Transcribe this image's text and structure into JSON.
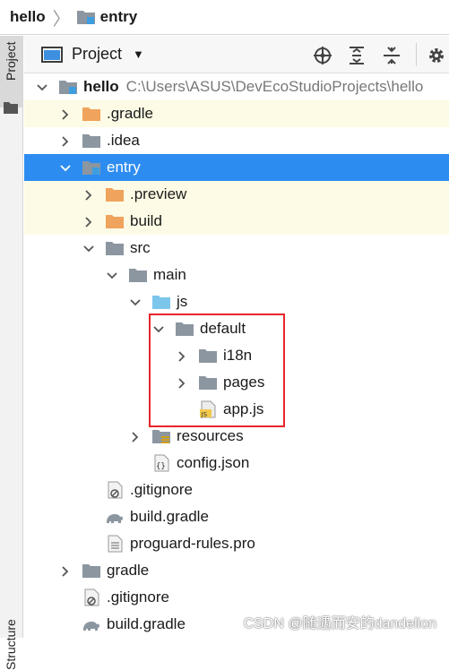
{
  "breadcrumb": {
    "project": "hello",
    "module": "entry"
  },
  "sidebar": {
    "tab_label": "Project",
    "bottom_label": "Structure"
  },
  "panel": {
    "title": "Project"
  },
  "tree": [
    {
      "label": "hello",
      "suffix": "C:\\Users\\ASUS\\DevEcoStudioProjects\\hello",
      "icon": "module-folder-icon",
      "arrow": "expanded",
      "bold": true
    },
    {
      "label": ".gradle",
      "icon": "orange-folder-icon",
      "arrow": "collapsed",
      "highlight": true
    },
    {
      "label": ".idea",
      "icon": "gray-folder-icon",
      "arrow": "collapsed"
    },
    {
      "label": "entry",
      "icon": "module-folder-icon",
      "arrow": "expanded",
      "selected": true
    },
    {
      "label": ".preview",
      "icon": "orange-folder-icon",
      "arrow": "collapsed",
      "highlight": true
    },
    {
      "label": "build",
      "icon": "orange-folder-icon",
      "arrow": "collapsed",
      "highlight": true
    },
    {
      "label": "src",
      "icon": "gray-folder-icon",
      "arrow": "expanded"
    },
    {
      "label": "main",
      "icon": "gray-folder-icon",
      "arrow": "expanded"
    },
    {
      "label": "js",
      "icon": "blue-folder-icon",
      "arrow": "expanded"
    },
    {
      "label": "default",
      "icon": "gray-folder-icon",
      "arrow": "expanded"
    },
    {
      "label": "i18n",
      "icon": "gray-folder-icon",
      "arrow": "collapsed"
    },
    {
      "label": "pages",
      "icon": "gray-folder-icon",
      "arrow": "collapsed"
    },
    {
      "label": "app.js",
      "icon": "js-file-icon",
      "arrow": "none"
    },
    {
      "label": "resources",
      "icon": "resources-folder-icon",
      "arrow": "collapsed"
    },
    {
      "label": "config.json",
      "icon": "json-file-icon",
      "arrow": "none"
    },
    {
      "label": ".gitignore",
      "icon": "gitignore-file-icon",
      "arrow": "none"
    },
    {
      "label": "build.gradle",
      "icon": "gradle-file-icon",
      "arrow": "none"
    },
    {
      "label": "proguard-rules.pro",
      "icon": "text-file-icon",
      "arrow": "none"
    },
    {
      "label": "gradle",
      "icon": "gray-folder-icon",
      "arrow": "collapsed"
    },
    {
      "label": ".gitignore",
      "icon": "gitignore-file-icon",
      "arrow": "none"
    },
    {
      "label": "build.gradle",
      "icon": "gradle-file-icon",
      "arrow": "none"
    }
  ],
  "watermark": "CSDN @随遇而安的dandelion"
}
